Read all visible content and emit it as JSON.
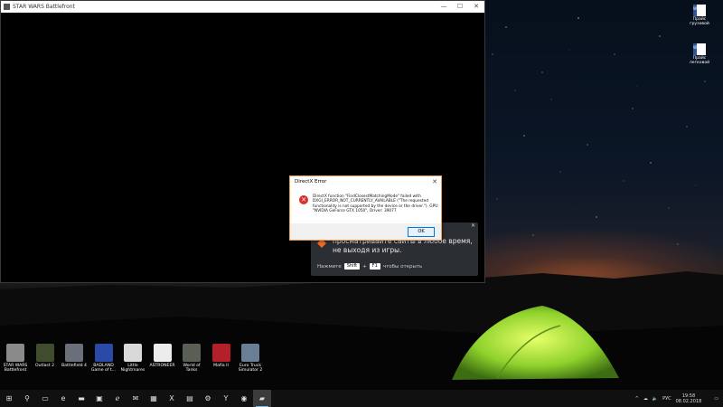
{
  "game_window": {
    "title": "STAR WARS Battlefront",
    "controls": {
      "minimize": "—",
      "maximize": "☐",
      "close": "✕"
    }
  },
  "dialog": {
    "title": "DirectX Error",
    "close": "✕",
    "message": "DirectX function \"FindClosestMatchingMode\" failed with DXGI_ERROR_NOT_CURRENTLY_AVAILABLE (\"The requested functionality is not supported by the device or the driver.\"). GPU: \"NVIDIA GeForce GTX 1050\", Driver: 39077",
    "ok_label": "OK"
  },
  "overlay": {
    "close": "✕",
    "text": "и\nпросматривайте сайты в любое время,\nне выходя из игры.",
    "hint_prefix": "Нажмите",
    "key1": "Shift",
    "plus": "+",
    "key2": "F1",
    "hint_suffix": "чтобы открыть"
  },
  "desktop_right": [
    {
      "label": "Прайс грузовой"
    },
    {
      "label": "Прайс легковой"
    }
  ],
  "desktop_icons": [
    {
      "label": "STAR WARS Battlefront",
      "color": "#8a8a8a"
    },
    {
      "label": "Outlast 2",
      "color": "#3f4d2e"
    },
    {
      "label": "Battlefield 4",
      "color": "#6b6f7a"
    },
    {
      "label": "BADLAND Game of t...",
      "color": "#2b4aa8"
    },
    {
      "label": "Little Nightmares",
      "color": "#d9d9d9"
    },
    {
      "label": "ASTRONEER",
      "color": "#ececec"
    },
    {
      "label": "World of Tanks",
      "color": "#5a5f55"
    },
    {
      "label": "Mafia II",
      "color": "#b3202a"
    },
    {
      "label": "Euro Truck Simulator 2",
      "color": "#6a7f96"
    }
  ],
  "taskbar": {
    "icons": [
      {
        "name": "start-icon",
        "glyph": "⊞"
      },
      {
        "name": "search-icon",
        "glyph": "⚲"
      },
      {
        "name": "task-view-icon",
        "glyph": "▭"
      },
      {
        "name": "edge-icon",
        "glyph": "e"
      },
      {
        "name": "explorer-icon",
        "glyph": "▬"
      },
      {
        "name": "store-icon",
        "glyph": "▣"
      },
      {
        "name": "ie-icon",
        "glyph": "ℯ"
      },
      {
        "name": "mail-icon",
        "glyph": "✉"
      },
      {
        "name": "photos-icon",
        "glyph": "▦"
      },
      {
        "name": "excel-icon",
        "glyph": "X"
      },
      {
        "name": "app-icon",
        "glyph": "▤"
      },
      {
        "name": "settings-icon",
        "glyph": "⚙"
      },
      {
        "name": "yandex-icon",
        "glyph": "Y"
      },
      {
        "name": "media-icon",
        "glyph": "◉"
      },
      {
        "name": "battlefront-icon",
        "glyph": "▰"
      }
    ],
    "tray": {
      "chevron": "^",
      "lang": "РУС",
      "time": "19:58",
      "date": "08.02.2018"
    }
  }
}
